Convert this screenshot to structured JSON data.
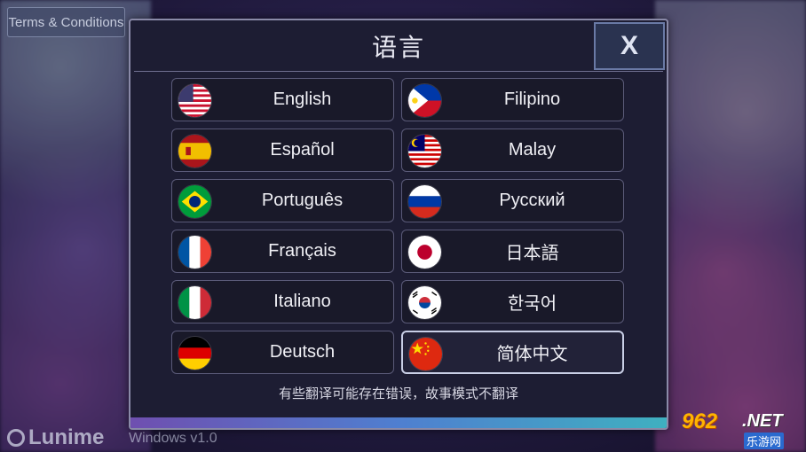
{
  "background": {
    "terms_button": "Terms & Conditions",
    "brand_name": "Lunime",
    "version": "Windows v1.0"
  },
  "watermark": {
    "number": "962",
    "domain": ".NET",
    "subtitle": "乐游网"
  },
  "dialog": {
    "title": "语言",
    "close_label": "X",
    "footer_note": "有些翻译可能存在错误，故事模式不翻译",
    "languages": [
      {
        "label": "English",
        "flag": "us-flag-icon",
        "selected": false
      },
      {
        "label": "Filipino",
        "flag": "philippines-flag-icon",
        "selected": false
      },
      {
        "label": "Español",
        "flag": "spain-flag-icon",
        "selected": false
      },
      {
        "label": "Malay",
        "flag": "malaysia-flag-icon",
        "selected": false
      },
      {
        "label": "Português",
        "flag": "brazil-flag-icon",
        "selected": false
      },
      {
        "label": "Русский",
        "flag": "russia-flag-icon",
        "selected": false
      },
      {
        "label": "Français",
        "flag": "france-flag-icon",
        "selected": false
      },
      {
        "label": "日本語",
        "flag": "japan-flag-icon",
        "selected": false
      },
      {
        "label": "Italiano",
        "flag": "italy-flag-icon",
        "selected": false
      },
      {
        "label": "한국어",
        "flag": "korea-flag-icon",
        "selected": false
      },
      {
        "label": "Deutsch",
        "flag": "germany-flag-icon",
        "selected": false
      },
      {
        "label": "简体中文",
        "flag": "china-flag-icon",
        "selected": true
      }
    ]
  }
}
